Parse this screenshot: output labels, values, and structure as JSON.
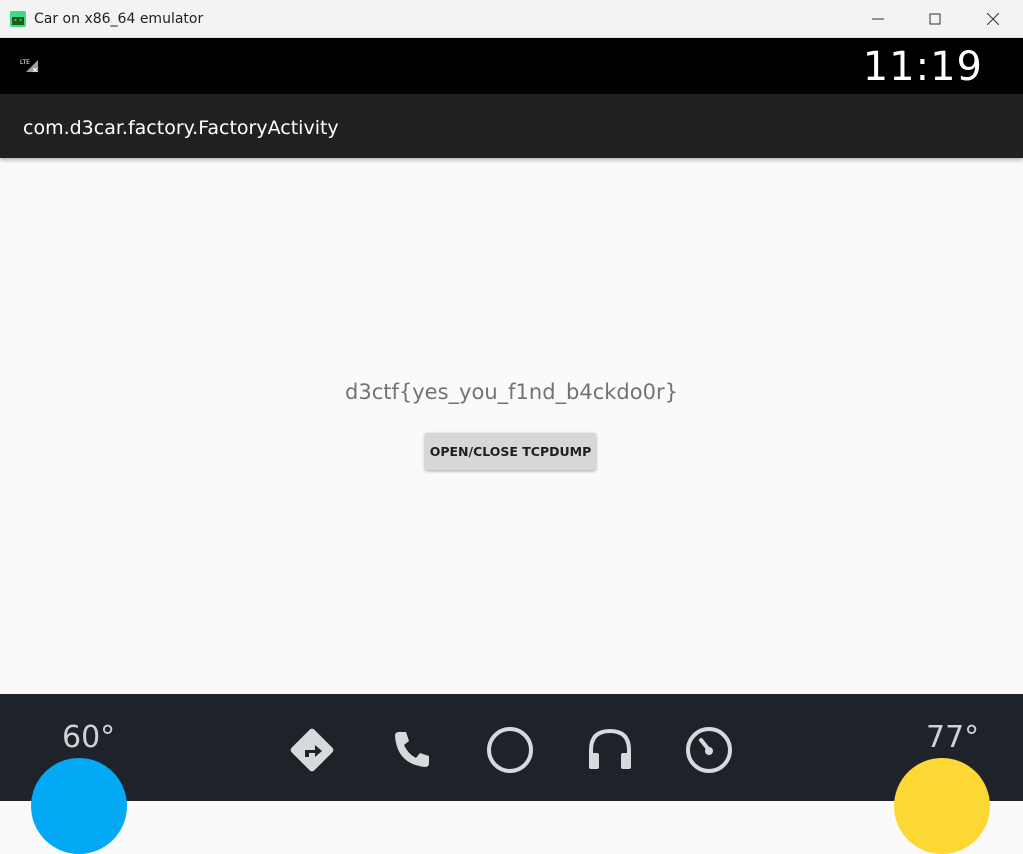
{
  "window": {
    "title": "Car on x86_64 emulator"
  },
  "status_bar": {
    "time": "11:19",
    "network": "LTE"
  },
  "app_bar": {
    "title": "com.d3car.factory.FactoryActivity"
  },
  "content": {
    "flag_text": "d3ctf{yes_you_f1nd_b4ckdo0r}",
    "button_label": "OPEN/CLOSE TCPDUMP"
  },
  "nav": {
    "left_temp": "60°",
    "right_temp": "77°",
    "icons": [
      "navigation-icon",
      "phone-icon",
      "home-icon",
      "headphones-icon",
      "dashboard-icon"
    ]
  },
  "colors": {
    "left_knob": "#03a9f4",
    "right_knob": "#fdd835",
    "app_bar": "#212121",
    "nav_bar": "#1d2329"
  }
}
